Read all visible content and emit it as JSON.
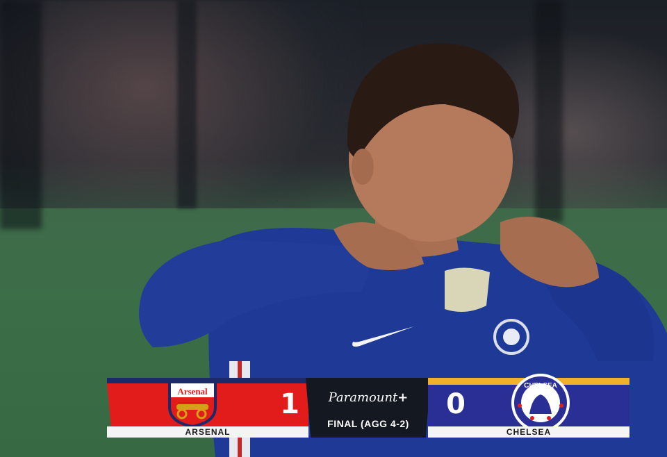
{
  "scoreboard": {
    "home": {
      "name": "ARSENAL",
      "score": "1",
      "crest_text": "Arsenal",
      "color": "#e21b1b",
      "band_color": "#1c2a6a"
    },
    "away": {
      "name": "CHELSEA",
      "score": "0",
      "crest_text": "CHELSEA",
      "color": "#2a2f96",
      "band_color": "#f2b12a"
    },
    "broadcaster": "Paramount",
    "broadcaster_plus": "+",
    "status": "FINAL (AGG 4-2)"
  },
  "icons": {
    "home_crest": "arsenal-crest-icon",
    "away_crest": "chelsea-crest-icon",
    "shirt_logo": "nike-swoosh-icon"
  }
}
